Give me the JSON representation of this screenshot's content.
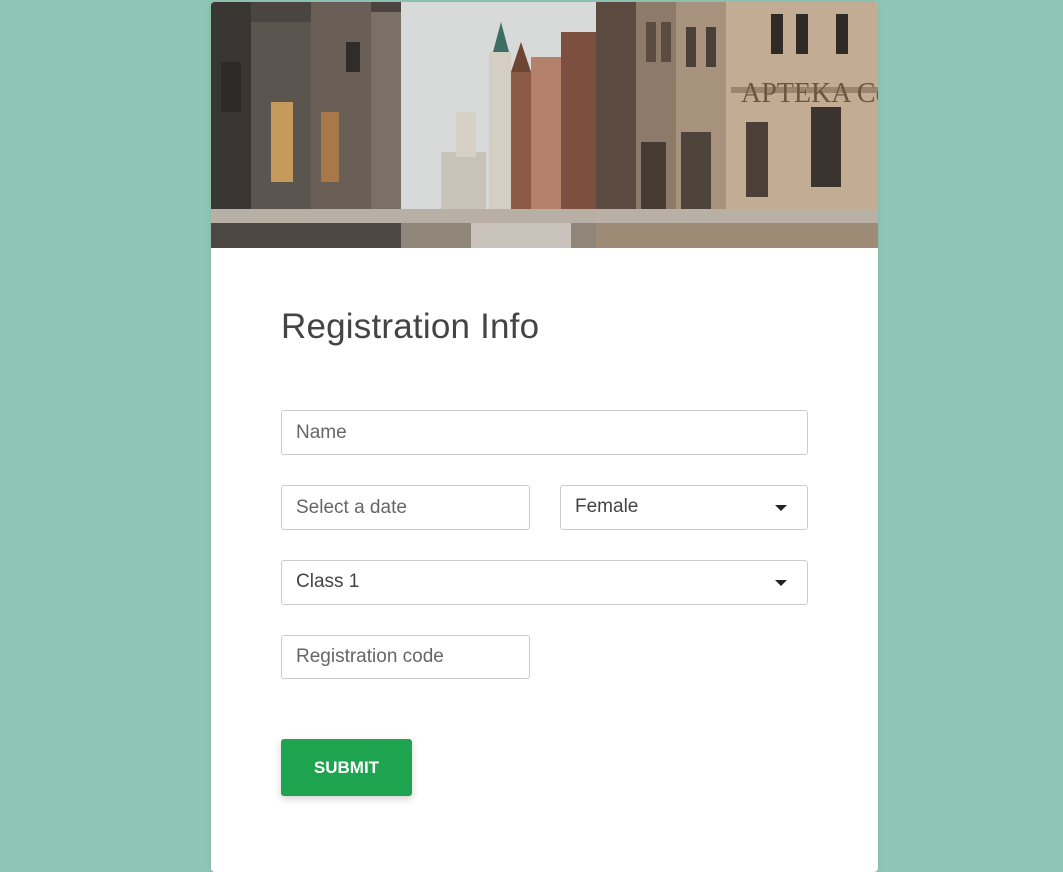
{
  "form": {
    "title": "Registration Info",
    "name_placeholder": "Name",
    "date_placeholder": "Select a date",
    "gender_value": "Female",
    "class_value": "Class 1",
    "code_placeholder": "Registration code",
    "submit_label": "SUBMIT"
  },
  "colors": {
    "background": "#8fc5b5",
    "card": "#ffffff",
    "submit": "#1ea34f",
    "title_text": "#444444"
  },
  "icons": {
    "dropdown": "caret-down-icon"
  }
}
